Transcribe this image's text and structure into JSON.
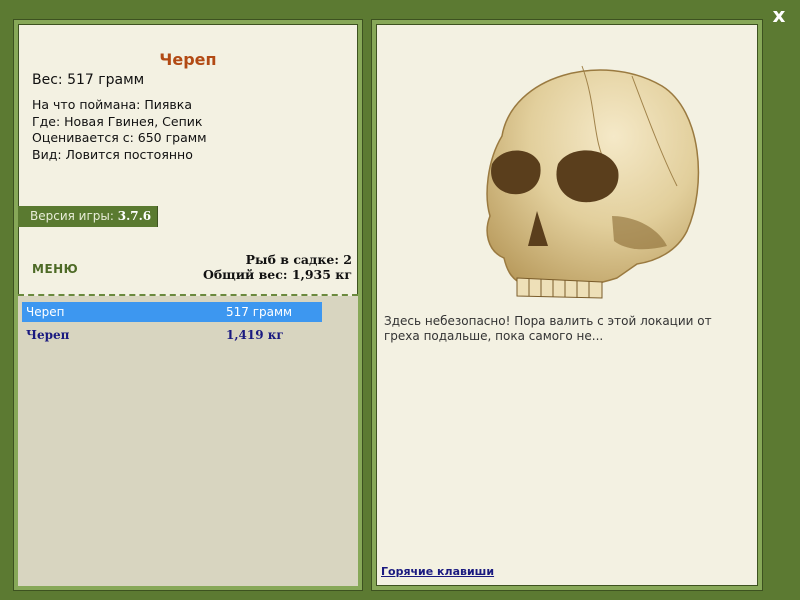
{
  "close_label": "x",
  "item": {
    "title": "Череп",
    "weight_line": "Вес: 517 грамм",
    "caught_on": "На что поймана: Пиявка",
    "location": "Где: Новая Гвинея, Сепик",
    "valued_from": "Оценивается с: 650 грамм",
    "kind": "Вид: Ловится постоянно"
  },
  "version": {
    "label": "Версия игры:",
    "number": "3.7.6"
  },
  "menu_label": "МЕНЮ",
  "stats": {
    "fish_in_keepnet": "Рыб в садке: 2",
    "total_weight": "Общий вес: 1,935 кг"
  },
  "catch_list": [
    {
      "name": "Череп",
      "weight": "517 грамм"
    },
    {
      "name": "Череп",
      "weight": "1,419 кг"
    }
  ],
  "description": "Здесь небезопасно! Пора валить с этой локации от греха подальше, пока самого не...",
  "hotkeys_label": "Горячие клавиши",
  "colors": {
    "background": "#5c7a32",
    "panel": "#f3f1e2",
    "title": "#b24a14",
    "selection": "#3d97f0",
    "link": "#1a1a80"
  }
}
